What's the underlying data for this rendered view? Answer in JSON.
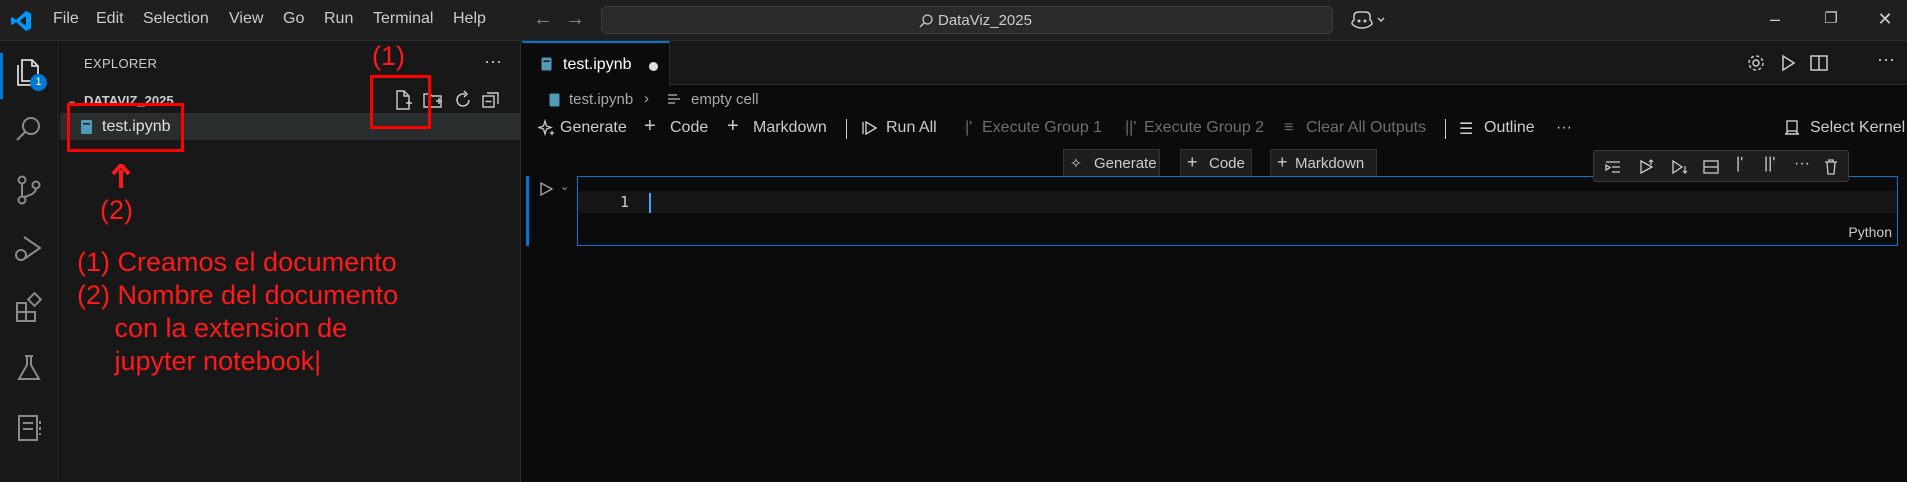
{
  "menubar": {
    "items": [
      "File",
      "Edit",
      "Selection",
      "View",
      "Go",
      "Run",
      "Terminal",
      "Help"
    ]
  },
  "command_center": {
    "text": "DataViz_2025"
  },
  "activity_bar": {
    "explorer_badge": "1"
  },
  "explorer": {
    "title": "EXPLORER",
    "more": "···",
    "folder_name": "DATAVIZ_2025",
    "files": [
      {
        "name": "test.ipynb"
      }
    ]
  },
  "annotations": {
    "label_1": "(1)",
    "label_2": "(2)",
    "note_line_1": "(1) Creamos el documento",
    "note_line_2": "(2) Nombre del documento",
    "note_line_3": "     con la extension de",
    "note_line_4": "     jupyter notebook|",
    "color": "#ff0000"
  },
  "editor": {
    "tab": {
      "label": "test.ipynb",
      "dirty": true
    },
    "breadcrumb": {
      "file": "test.ipynb",
      "cell": "empty cell"
    },
    "toolbar": {
      "generate": "Generate",
      "code": "Code",
      "markdown": "Markdown",
      "run_all": "Run All",
      "execute_group_1": "Execute Group 1",
      "execute_group_2": "Execute Group 2",
      "clear_outputs": "Clear All Outputs",
      "outline": "Outline",
      "more": "···",
      "select_kernel": "Select Kernel"
    },
    "insert_bar": {
      "generate": "Generate",
      "code": "Code",
      "markdown": "Markdown"
    },
    "cell": {
      "line_number": "1",
      "language": "Python",
      "more": "···"
    }
  },
  "colors": {
    "accent": "#0078d4",
    "background": "#0b0b0b",
    "sidebar": "#181818"
  }
}
